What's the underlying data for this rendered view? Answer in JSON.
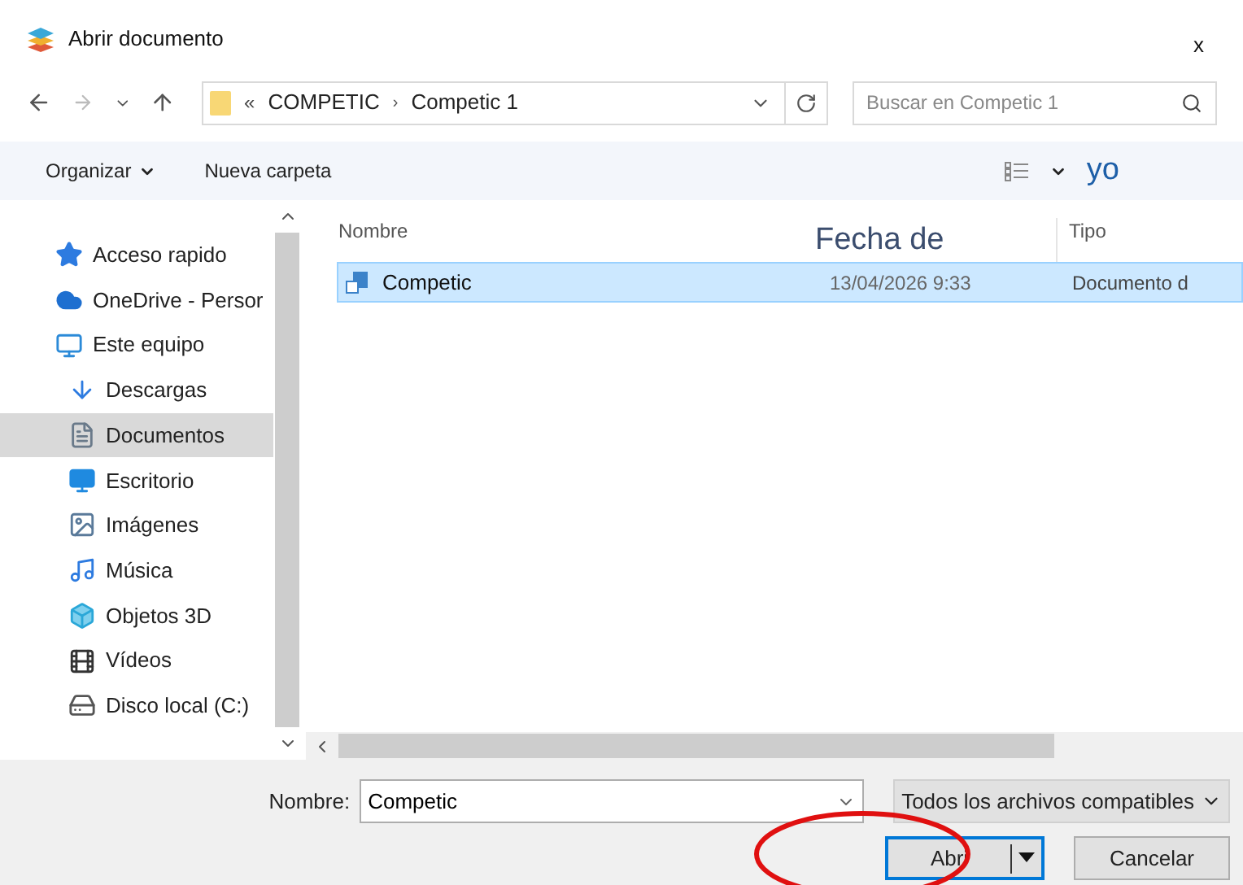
{
  "window": {
    "title": "Abrir documento",
    "close": "x"
  },
  "address": {
    "prefix": "«",
    "separator": "›",
    "path": [
      "COMPETIC",
      "Competic 1"
    ],
    "search_placeholder": "Buscar en Competic 1"
  },
  "toolbar": {
    "organize": "Organizar",
    "new_folder": "Nueva carpeta",
    "note": "yo"
  },
  "sidebar": {
    "items": [
      {
        "label": "Acceso rapido",
        "kind": "star",
        "selected": false
      },
      {
        "label": "OneDrive - Persor",
        "kind": "cloud",
        "selected": false
      },
      {
        "label": "Este equipo",
        "kind": "pc",
        "selected": false,
        "children": [
          {
            "label": "Descargas",
            "kind": "download",
            "selected": false
          },
          {
            "label": "Documentos",
            "kind": "document",
            "selected": true
          },
          {
            "label": "Escritorio",
            "kind": "desktop",
            "selected": false
          },
          {
            "label": "Imágenes",
            "kind": "image",
            "selected": false
          },
          {
            "label": "Música",
            "kind": "music",
            "selected": false
          },
          {
            "label": "Objetos 3D",
            "kind": "cube",
            "selected": false
          },
          {
            "label": "Vídeos",
            "kind": "film",
            "selected": false
          },
          {
            "label": "Disco local (C:)",
            "kind": "disk",
            "selected": false
          }
        ]
      }
    ]
  },
  "table": {
    "columns": [
      "Nombre",
      "Fecha de",
      "Tipo"
    ],
    "rows": [
      {
        "cells": [
          "Competic",
          "13/04/2026 9:33",
          "Documento d"
        ],
        "selected": true
      }
    ]
  },
  "footer": {
    "name_label": "Nombre:",
    "name_value": "Competic",
    "filter": "Todos los archivos compatibles",
    "open": "Abri",
    "cancel": "Cancelar"
  }
}
